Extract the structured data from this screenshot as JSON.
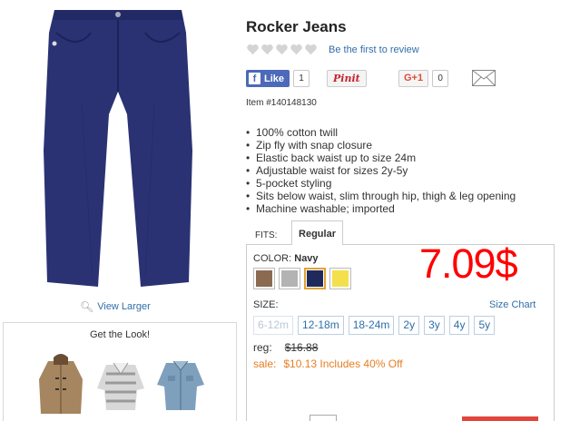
{
  "product": {
    "title": "Rocker Jeans",
    "review_link": "Be the first to review",
    "item_number": "Item #140148130",
    "view_larger": "View Larger"
  },
  "social": {
    "facebook_label": "Like",
    "facebook_count": "1",
    "pinterest_label": "Pinit",
    "gplus_label": "G+1",
    "gplus_count": "0"
  },
  "features": [
    "100% cotton twill",
    "Zip fly with snap closure",
    "Elastic back waist up to size 24m",
    "Adjustable waist for sizes 2y-5y",
    "5-pocket styling",
    "Sits below waist, slim through hip, thigh & leg opening",
    "Machine washable; imported"
  ],
  "fits": {
    "label": "FITS:",
    "selected_tab": "Regular"
  },
  "color": {
    "label": "COLOR:",
    "selected": "Navy",
    "swatches": [
      "#8b6a52",
      "#b3b3b3",
      "#1f2a5c",
      "#f4e04d"
    ],
    "selected_index": 2
  },
  "price_overlay": "7.09$",
  "size": {
    "label": "SIZE:",
    "chart_link": "Size Chart",
    "options": [
      {
        "label": "6-12m",
        "available": false
      },
      {
        "label": "12-18m",
        "available": true
      },
      {
        "label": "18-24m",
        "available": true
      },
      {
        "label": "2y",
        "available": true
      },
      {
        "label": "3y",
        "available": true
      },
      {
        "label": "4y",
        "available": true
      },
      {
        "label": "5y",
        "available": true
      }
    ]
  },
  "pricing": {
    "reg_label": "reg:",
    "reg_price": "$16.88",
    "sale_label": "sale:",
    "sale_text": "$10.13 Includes 40% Off"
  },
  "get_the_look": {
    "title": "Get the Look!"
  },
  "rating": {
    "hearts_filled": 0,
    "hearts_total": 5
  }
}
